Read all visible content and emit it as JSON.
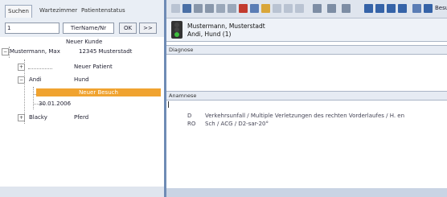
{
  "tabs": [
    "Suchen",
    "Wartezimmer",
    "Patientenstatus"
  ],
  "search": {
    "value": "1",
    "filter": "TierName/Nr",
    "ok_label": "OK",
    "next_label": ">>"
  },
  "tree": {
    "new_customer": "Neuer Kunde",
    "owner_name": "Mustermann, Max",
    "owner_address": "12345 Musterstadt",
    "new_patient": "Neuer Patient",
    "pet1_name": "Andi",
    "pet1_species": "Hund",
    "new_visit": "Neuer Besuch",
    "visit_date": "30.01.2006",
    "pet2_name": "Blacky",
    "pet2_species": "Pferd"
  },
  "toolbar": {
    "help_label": "Besuch"
  },
  "patient": {
    "owner_line": "Mustermann, Musterstadt",
    "pet_line": "Andi, Hund (1)"
  },
  "sections": {
    "diagnose": "Diagnose",
    "anamnese": "Anamnese"
  },
  "anamnese": [
    {
      "code": "D",
      "text": "Verkehrsunfall / Multiple Verletzungen des rechten Vorderlaufes / H. en"
    },
    {
      "code": "RO",
      "text": "Sch / ACG / D2-sar-20°"
    }
  ],
  "colors": {
    "selection": "#f0a330",
    "pane_border": "#6e8bb5",
    "background": "#c9d4e4"
  }
}
